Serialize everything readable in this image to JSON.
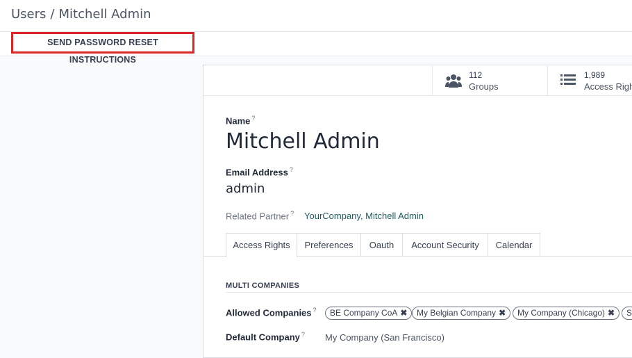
{
  "breadcrumb": {
    "parent": "Users",
    "separator": "/",
    "current": "Mitchell Admin"
  },
  "actions": {
    "reset_password": "SEND PASSWORD RESET INSTRUCTIONS"
  },
  "stats": [
    {
      "value": "112",
      "label": "Groups",
      "icon": "users-icon"
    },
    {
      "value": "1,989",
      "label": "Access Rights",
      "icon": "list-icon"
    }
  ],
  "form": {
    "name_label": "Name",
    "name_value": "Mitchell Admin",
    "email_label": "Email Address",
    "email_value": "admin",
    "help_mark": "?",
    "related_partner_label": "Related Partner",
    "related_partner_value": "YourCompany, Mitchell Admin"
  },
  "tabs": [
    "Access Rights",
    "Preferences",
    "Oauth",
    "Account Security",
    "Calendar"
  ],
  "active_tab": "Access Rights",
  "multi_companies": {
    "section_title": "MULTI COMPANIES",
    "allowed_label": "Allowed Companies",
    "allowed": [
      "BE Company CoA",
      "My Belgian Company",
      "My Company (Chicago)",
      "SF"
    ],
    "remove_glyph": "✖",
    "default_label": "Default Company",
    "default_value": "My Company (San Francisco)"
  },
  "colors": {
    "highlight": "#dc2626",
    "link": "#1f5c63",
    "text": "#374151"
  }
}
